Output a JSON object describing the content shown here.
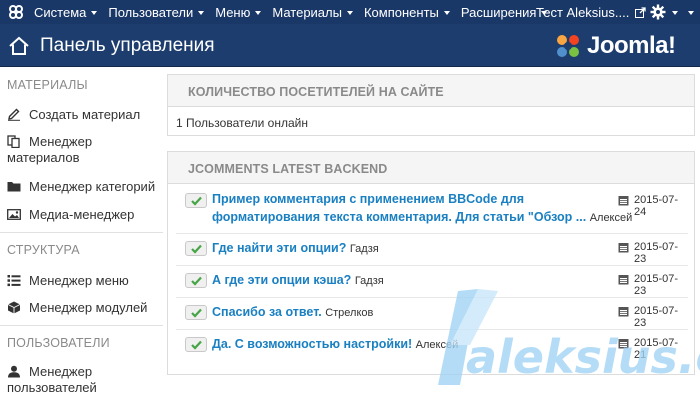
{
  "topbar": {
    "menu": [
      {
        "label": "Система"
      },
      {
        "label": "Пользователи"
      },
      {
        "label": "Меню"
      },
      {
        "label": "Материалы"
      },
      {
        "label": "Компоненты"
      },
      {
        "label": "Расширения"
      }
    ],
    "site_name": "Тест Aleksius....",
    "bar_color": "#1a3867"
  },
  "header": {
    "title": "Панель управления",
    "brand": "Joomla!",
    "header_color": "#1c3d6e"
  },
  "sidebar": {
    "sections": [
      {
        "title": "МАТЕРИАЛЫ",
        "items": [
          {
            "label": "Создать материал",
            "icon": "pencil-icon"
          },
          {
            "label": "Менеджер материалов",
            "icon": "copy-icon"
          },
          {
            "label": "Менеджер категорий",
            "icon": "folder-icon"
          },
          {
            "label": "Медиа-менеджер",
            "icon": "image-icon"
          }
        ]
      },
      {
        "title": "СТРУКТУРА",
        "items": [
          {
            "label": "Менеджер меню",
            "icon": "list-icon"
          },
          {
            "label": "Менеджер модулей",
            "icon": "cube-icon"
          }
        ]
      },
      {
        "title": "ПОЛЬЗОВАТЕЛИ",
        "items": [
          {
            "label": "Менеджер пользователей",
            "icon": "user-icon"
          }
        ]
      }
    ]
  },
  "visitors": {
    "title": "КОЛИЧЕСТВО ПОСЕТИТЕЛЕЙ НА САЙТЕ",
    "text": "1 Пользователи онлайн"
  },
  "comments": {
    "title": "JCOMMENTS LATEST BACKEND",
    "link_color": "#1a80c2",
    "items": [
      {
        "text_line1": "Пример комментария с применением BBCode для",
        "text_line2": "форматирования текста комментария. Для статьи \"Обзор ...",
        "author": "Алексей",
        "date": "2015-07-24"
      },
      {
        "text_line1": "Где найти эти опции?",
        "author": "Гадзя",
        "date": "2015-07-23"
      },
      {
        "text_line1": "А где эти опции кэша?",
        "author": "Гадзя",
        "date": "2015-07-23"
      },
      {
        "text_line1": "Спасибо за ответ.",
        "author": "Стрелков",
        "date": "2015-07-23"
      },
      {
        "text_line1": "Да. С возможностью настройки!",
        "author": "Алексей",
        "date": "2015-07-21"
      }
    ]
  },
  "watermark": {
    "text": "aleksius.com"
  }
}
